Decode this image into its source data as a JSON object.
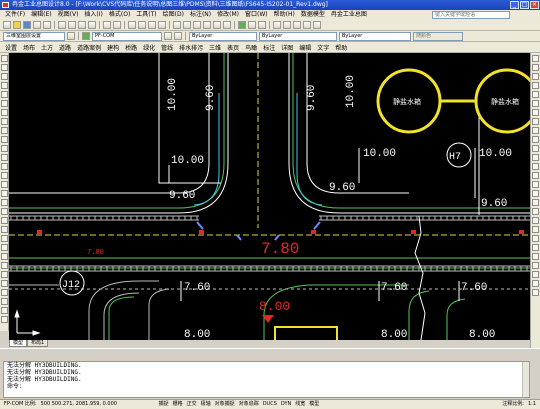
{
  "window": {
    "title": "冉金工业总图设计8.0 - [F:\\Work\\CVS代码库\\任务说明\\总图三维\\PDMS\\资料\\三维图纸\\FS645-IS202-01_Rev1.dwg]",
    "min": "_",
    "max": "□",
    "close": "×"
  },
  "menu": {
    "items": [
      "文件(F)",
      "编辑(E)",
      "视图(V)",
      "插入(I)",
      "格式(O)",
      "工具(T)",
      "绘图(D)",
      "标注(N)",
      "修改(M)",
      "窗口(W)",
      "帮助(H)",
      "数据模型",
      "冉金工业总图"
    ],
    "search_placeholder": "键入关键字或短语"
  },
  "toolbar2": {
    "style_select": "三维室图层设置",
    "layer_select": "PF-COM",
    "bylayer_color": "ByLayer",
    "bylayer_linetype": "ByLayer",
    "bylayer_lineweight": "ByLayer",
    "plot_style": "随颜色"
  },
  "toolbar3": {
    "commands": [
      "设置",
      "场布",
      "土方",
      "道路",
      "道路案例",
      "建构",
      "桥路",
      "绿化",
      "管线",
      "排水排污",
      "三维",
      "表页",
      "鸟瞰",
      "标注",
      "详图",
      "编辑",
      "文字",
      "帮助"
    ]
  },
  "drawing": {
    "labels": {
      "el_1000_tl": "10.00",
      "el_960_tl": "9.60",
      "el_1000_l": "10.00",
      "el_960_l": "9.60",
      "el_1000_c": "10.00",
      "el_960_c": "9.60",
      "el_1000_r": "10.00",
      "el_960_r": "9.60",
      "el_780_small": "7.80",
      "el_780_big": "7.80",
      "el_800": "8.00",
      "el_760_a": "7.60",
      "el_760_b": "7.60",
      "el_760_c": "7.60",
      "el_800_a": "8.00",
      "el_800_b": "8.00",
      "el_800_c": "8.00",
      "tag_h7": "H7",
      "tag_j12": "J12",
      "tank_1": "静盐水箱",
      "tank_2": "静盐水箱"
    }
  },
  "tabs": [
    "模型",
    "布局1"
  ],
  "command": {
    "lines": [
      "无法分解 HY3DBUILDING.",
      "无法分解 HY3DBUILDING.",
      "无法分解 HY3DBUILDING."
    ],
    "prompt": "命令:"
  },
  "status": {
    "prefix": "FP-COM 比例:",
    "coords": "500 500.271, 2081.959, 0.000",
    "toggles": [
      "捕捉",
      "栅格",
      "正交",
      "极轴",
      "对象捕捉",
      "对象追踪",
      "DUCS",
      "DYN",
      "线宽",
      "模型"
    ],
    "scale_label": "注释比例:",
    "scale_value": "1:1"
  }
}
